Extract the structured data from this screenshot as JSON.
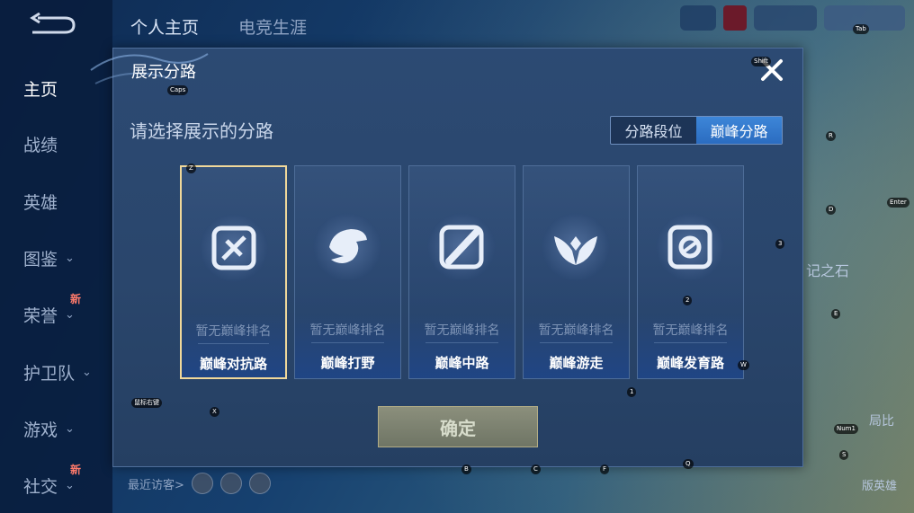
{
  "nav": {
    "items": [
      {
        "label": "主页",
        "active": true,
        "chevron": false,
        "badge": ""
      },
      {
        "label": "战绩",
        "active": false,
        "chevron": false,
        "badge": ""
      },
      {
        "label": "英雄",
        "active": false,
        "chevron": false,
        "badge": ""
      },
      {
        "label": "图鉴",
        "active": false,
        "chevron": true,
        "badge": ""
      },
      {
        "label": "荣誉",
        "active": false,
        "chevron": true,
        "badge": "新"
      },
      {
        "label": "护卫队",
        "active": false,
        "chevron": true,
        "badge": ""
      },
      {
        "label": "游戏",
        "active": false,
        "chevron": true,
        "badge": ""
      },
      {
        "label": "社交",
        "active": false,
        "chevron": true,
        "badge": "新"
      }
    ],
    "chevron_glyph": "⌄"
  },
  "top_tabs": [
    "个人主页",
    "电竞生涯"
  ],
  "background_text": {
    "stone": "记之石",
    "visitors_label": "最近访客>",
    "right_label_1": "局比",
    "right_label_2": "版英雄"
  },
  "key_hints": {
    "caps": "Caps",
    "shift": "Shift",
    "tab": "Tab",
    "enter": "Enter",
    "z": "Z",
    "x": "X",
    "r": "R",
    "d": "D",
    "e": "E",
    "w": "W",
    "num3": "3",
    "num2": "2",
    "num1": "1",
    "num1_key": "Num1",
    "s": "S",
    "b": "B",
    "c": "C",
    "f": "F",
    "q": "Q",
    "space": "鼠标右键"
  },
  "dialog": {
    "title": "展示分路",
    "section_title": "请选择展示的分路",
    "toggle": {
      "options": [
        "分路段位",
        "巅峰分路"
      ],
      "active_index": 1
    },
    "lanes": [
      {
        "name": "巅峰对抗路",
        "rank": "暂无巅峰排名",
        "icon": "sword-lane-icon",
        "selected": true
      },
      {
        "name": "巅峰打野",
        "rank": "暂无巅峰排名",
        "icon": "dragon-jungle-icon",
        "selected": false
      },
      {
        "name": "巅峰中路",
        "rank": "暂无巅峰排名",
        "icon": "mid-lane-icon",
        "selected": false
      },
      {
        "name": "巅峰游走",
        "rank": "暂无巅峰排名",
        "icon": "wings-roam-icon",
        "selected": false
      },
      {
        "name": "巅峰发育路",
        "rank": "暂无巅峰排名",
        "icon": "farm-lane-icon",
        "selected": false
      }
    ],
    "confirm_label": "确定"
  },
  "colors": {
    "accent_blue": "#2b6cc0",
    "selected_border": "#f0d89a",
    "new_badge": "#ff7a6b"
  }
}
